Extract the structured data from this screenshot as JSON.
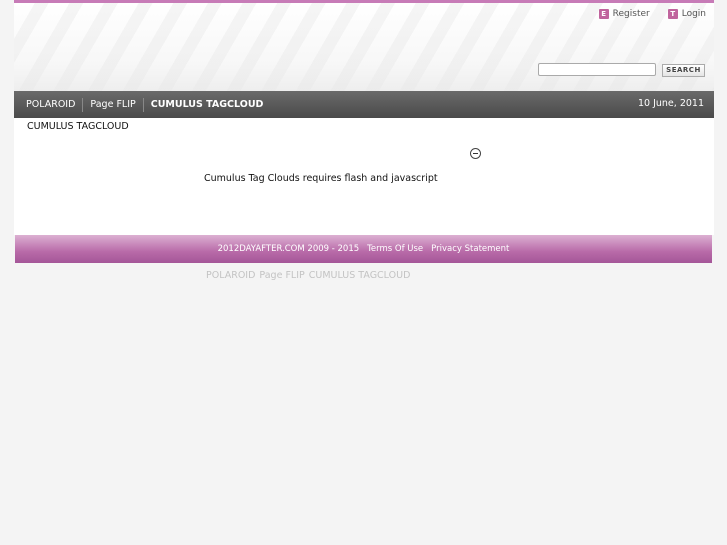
{
  "header": {
    "register_icon": "E",
    "register_label": "Register",
    "login_icon": "T",
    "login_label": "Login",
    "search_value": "",
    "search_button_label": "SEARCH"
  },
  "nav": {
    "items": [
      {
        "label": "POLAROID"
      },
      {
        "label": "Page FLIP"
      },
      {
        "label": "CUMULUS TAGCLOUD"
      }
    ],
    "date": "10 June, 2011"
  },
  "content": {
    "title": "CUMULUS TAGCLOUD",
    "flash_notice": "Cumulus Tag Clouds requires flash and javascript"
  },
  "footer": {
    "copyright": "2012DAYAFTER.COM 2009 - 2015",
    "terms": "Terms Of Use",
    "privacy": "Privacy Statement"
  },
  "bottom_links": [
    "POLAROID",
    "Page FLIP",
    "CUMULUS TAGCLOUD"
  ],
  "colors": {
    "accent": "#b86aa8",
    "nav": "#555555"
  }
}
